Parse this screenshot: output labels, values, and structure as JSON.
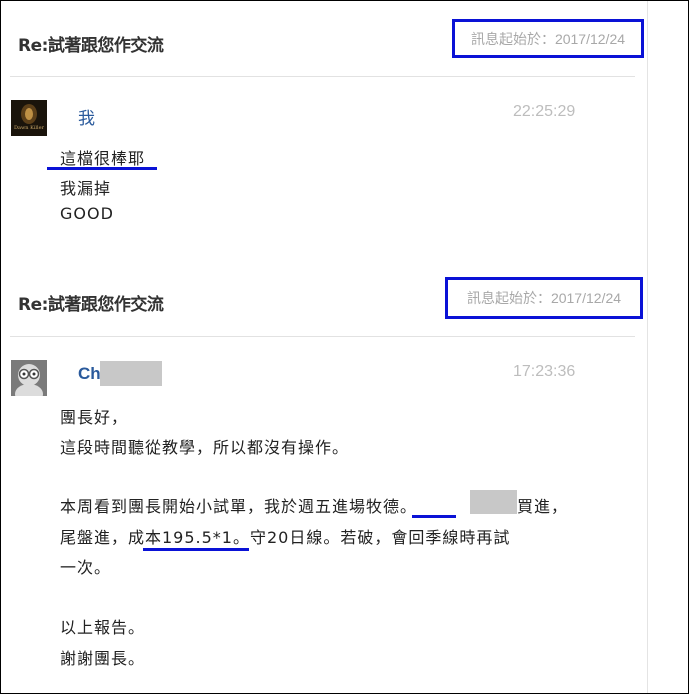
{
  "messages": [
    {
      "title_prefix": "Re:",
      "title": "試著跟您作交流",
      "date_text": "訊息起始於：2017/12/24",
      "author": "我",
      "time": "22:25:29",
      "avatar_text": "Dawn Killer",
      "body": [
        "這檔很棒耶",
        "我漏掉",
        "GOOD"
      ]
    },
    {
      "title_prefix": "Re:",
      "title": "試著跟您作交流",
      "date_text": "訊息起始於：2017/12/24",
      "author": "Ch",
      "time": "17:23:36",
      "body": [
        "團長好，",
        "這段時間聽從教學，所以都沒有操作。",
        "",
        "本周看到團長開始小試單，我於週五進場牧德。",
        "買進，",
        "尾盤進，成本195.5*1。守20日線。若破，會回季線時再試",
        "一次。",
        "",
        "以上報告。",
        "謝謝團長。"
      ]
    }
  ],
  "colors": {
    "highlight": "#0a12d6",
    "author": "#2a5a9c",
    "redaction": "#c8c8c8"
  }
}
